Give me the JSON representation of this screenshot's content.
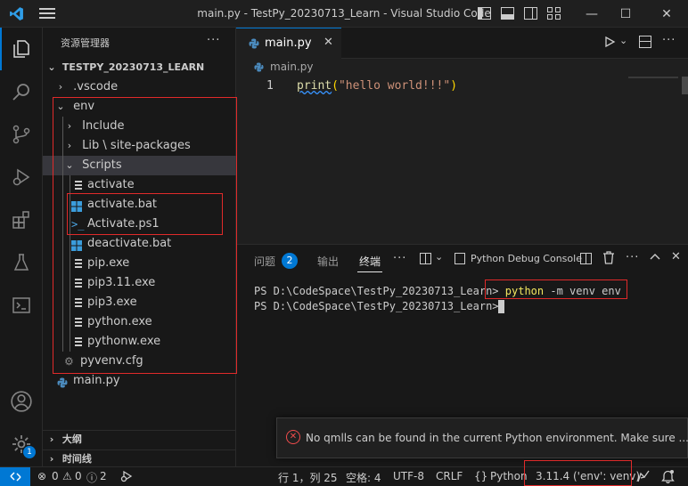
{
  "window": {
    "title": "main.py - TestPy_20230713_Learn - Visual Studio Code",
    "minimize": "—",
    "maximize": "☐",
    "close": "✕"
  },
  "sidebar": {
    "header": "资源管理器",
    "more": "···",
    "root": "TESTPY_20230713_LEARN",
    "items": [
      {
        "label": ".vscode"
      },
      {
        "label": "env"
      },
      {
        "label": "Include"
      },
      {
        "label": "Lib",
        "sublabel": "site-packages"
      },
      {
        "label": "Scripts"
      },
      {
        "label": "activate"
      },
      {
        "label": "activate.bat"
      },
      {
        "label": "Activate.ps1"
      },
      {
        "label": "deactivate.bat"
      },
      {
        "label": "pip.exe"
      },
      {
        "label": "pip3.11.exe"
      },
      {
        "label": "pip3.exe"
      },
      {
        "label": "python.exe"
      },
      {
        "label": "pythonw.exe"
      },
      {
        "label": "pyvenv.cfg"
      },
      {
        "label": "main.py"
      }
    ],
    "outline": "大纲",
    "timeline": "时间线"
  },
  "editor": {
    "tab_label": "main.py",
    "breadcrumb": "main.py",
    "line_number": "1",
    "code_func": "print",
    "code_open": "(",
    "code_string": "\"hello world!!!\"",
    "code_close": ")"
  },
  "panel": {
    "tabs": [
      "问题",
      "输出",
      "终端"
    ],
    "problems_count": "2",
    "more": "···",
    "debug_console": "Python Debug Console",
    "terminal_lines": [
      {
        "prompt": "PS D:\\CodeSpace\\TestPy_20230713_Learn>",
        "cmd": "python",
        "args": " -m venv env"
      },
      {
        "prompt": "PS D:\\CodeSpace\\TestPy_20230713_Learn>",
        "cmd": "",
        "args": ""
      }
    ]
  },
  "notification": {
    "message": "No qmlls can be found in the current Python environment. Make sure ..."
  },
  "statusbar": {
    "errors": "0",
    "warnings": "0",
    "info": "2",
    "position": "行 1，列 25",
    "spaces": "空格: 4",
    "encoding": "UTF-8",
    "eol": "CRLF",
    "language": "Python",
    "interpreter": "3.11.4 ('env': venv)",
    "settings_badge": "1"
  },
  "colors": {
    "accent": "#0078d4",
    "highlight": "#e02a2a",
    "string": "#ce9178",
    "function": "#dcdcaa",
    "error": "#f14c4c"
  }
}
